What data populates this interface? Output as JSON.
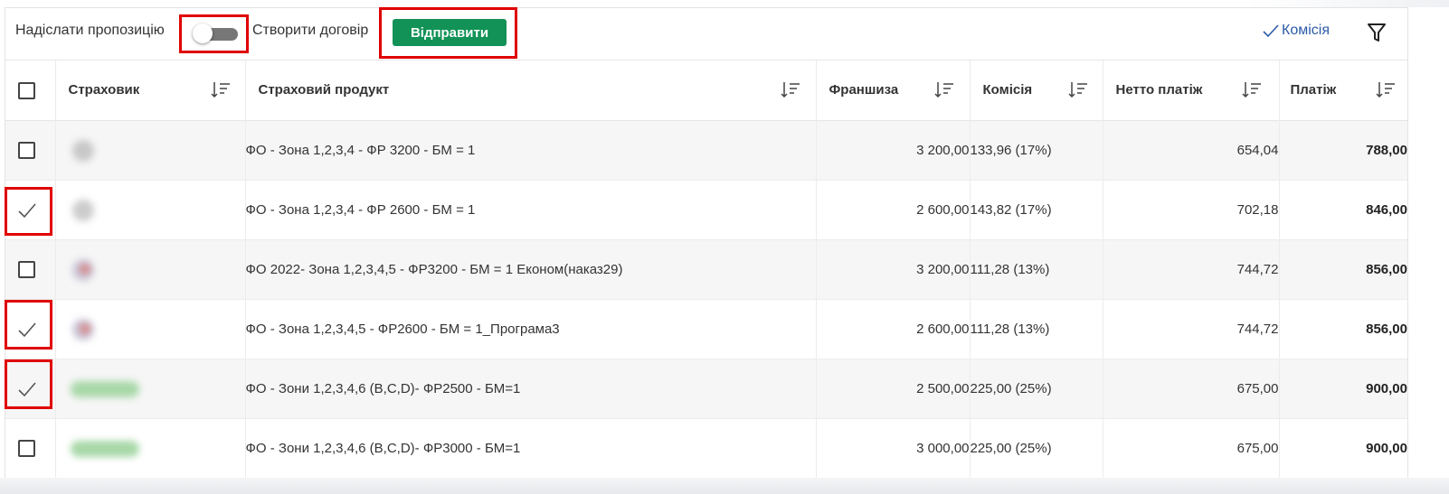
{
  "toolbar": {
    "send_offer_label": "Надіслати пропозицію",
    "create_contract_label": "Створити договір",
    "send_button_label": "Відправити",
    "commission_toggle_label": "Комісія",
    "toggle_on": false
  },
  "table": {
    "headers": {
      "insurer": "Страховик",
      "product": "Страховий продукт",
      "deductible": "Франшиза",
      "commission": "Комісія",
      "net_payment": "Нетто платіж",
      "payment": "Платіж"
    },
    "rows": [
      {
        "checked": false,
        "product": "ФО - Зона 1,2,3,4 - ФР 3200 - БМ = 1",
        "deductible": "3 200,00",
        "commission": "133,96 (17%)",
        "net_payment": "654,04",
        "payment": "788,00"
      },
      {
        "checked": true,
        "product": "ФО - Зона 1,2,3,4 - ФР 2600 - БМ = 1",
        "deductible": "2 600,00",
        "commission": "143,82 (17%)",
        "net_payment": "702,18",
        "payment": "846,00"
      },
      {
        "checked": false,
        "product": "ФО 2022- Зона 1,2,3,4,5 - ФР3200 - БМ = 1 Економ(наказ29)",
        "deductible": "3 200,00",
        "commission": "111,28 (13%)",
        "net_payment": "744,72",
        "payment": "856,00"
      },
      {
        "checked": true,
        "product": "ФО - Зона 1,2,3,4,5 - ФР2600 - БМ = 1_Програма3",
        "deductible": "2 600,00",
        "commission": "111,28 (13%)",
        "net_payment": "744,72",
        "payment": "856,00"
      },
      {
        "checked": true,
        "product": "ФО - Зони 1,2,3,4,6 (B,C,D)- ФР2500 - БМ=1",
        "deductible": "2 500,00",
        "commission": "225,00 (25%)",
        "net_payment": "675,00",
        "payment": "900,00"
      },
      {
        "checked": false,
        "product": "ФО - Зони 1,2,3,4,6 (B,C,D)- ФР3000 - БМ=1",
        "deductible": "3 000,00",
        "commission": "225,00 (25%)",
        "net_payment": "675,00",
        "payment": "900,00"
      }
    ]
  },
  "icons": {
    "sort": "sort-icon",
    "filter": "filter-icon",
    "check": "check-icon"
  },
  "colors": {
    "send_button": "#129256",
    "commission_link": "#2d5aa8",
    "highlight_box": "#e00000",
    "stripe_row": "#f6f6f6"
  }
}
